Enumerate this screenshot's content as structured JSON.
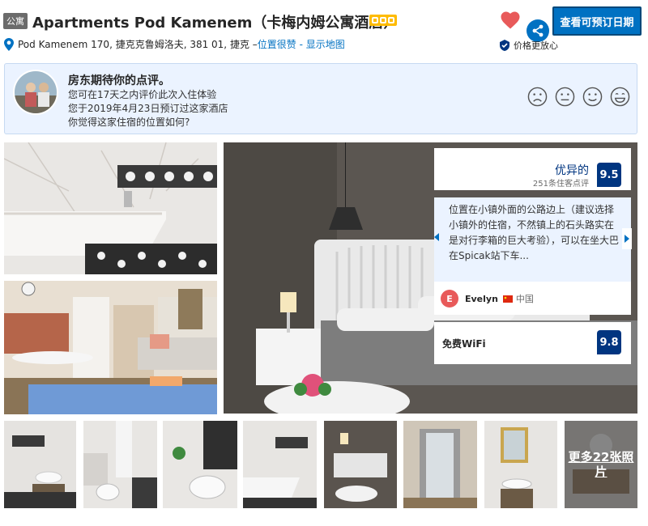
{
  "header": {
    "type_badge": "公寓",
    "hotel_name": "Apartments Pod Kamenem（卡梅内姆公寓酒店）",
    "stars": 3,
    "address": "Pod Kamenem 170, 捷克克鲁姆洛夫, 381 01, 捷克 – ",
    "location_link": "位置很赞",
    "map_separator": " - ",
    "map_link": "显示地图",
    "reserve_label": "查看可预订日期",
    "price_guarantee": "价格更放心"
  },
  "host_card": {
    "title": "房东期待你的点评。",
    "line1": "您可在17天之内评价此次入住体验",
    "line2": "您于2019年4月23日预订过这家酒店",
    "line3": "你觉得这家住宿的位置如何?",
    "faces": [
      "very-sad-face-icon",
      "neutral-face-icon",
      "smile-face-icon",
      "very-happy-face-icon"
    ]
  },
  "score": {
    "label": "优异的",
    "count": "251条住客点评",
    "value": "9.5"
  },
  "review": {
    "quote": "位置在小镇外面的公路边上（建议选择小镇外的住宿，不然镇上的石头路实在是对行李箱的巨大考验），可以在坐大巴在Spicak站下车...",
    "author_initial": "E",
    "author": "Evelyn",
    "country": "中国"
  },
  "wifi": {
    "label": "免费WiFi",
    "score": "9.8"
  },
  "gallery": {
    "more_photos": "更多22张照片"
  },
  "colors": {
    "brand_blue": "#0071c2",
    "dark_blue": "#003580",
    "star_yellow": "#febb02",
    "heart_red": "#e85a5a"
  }
}
